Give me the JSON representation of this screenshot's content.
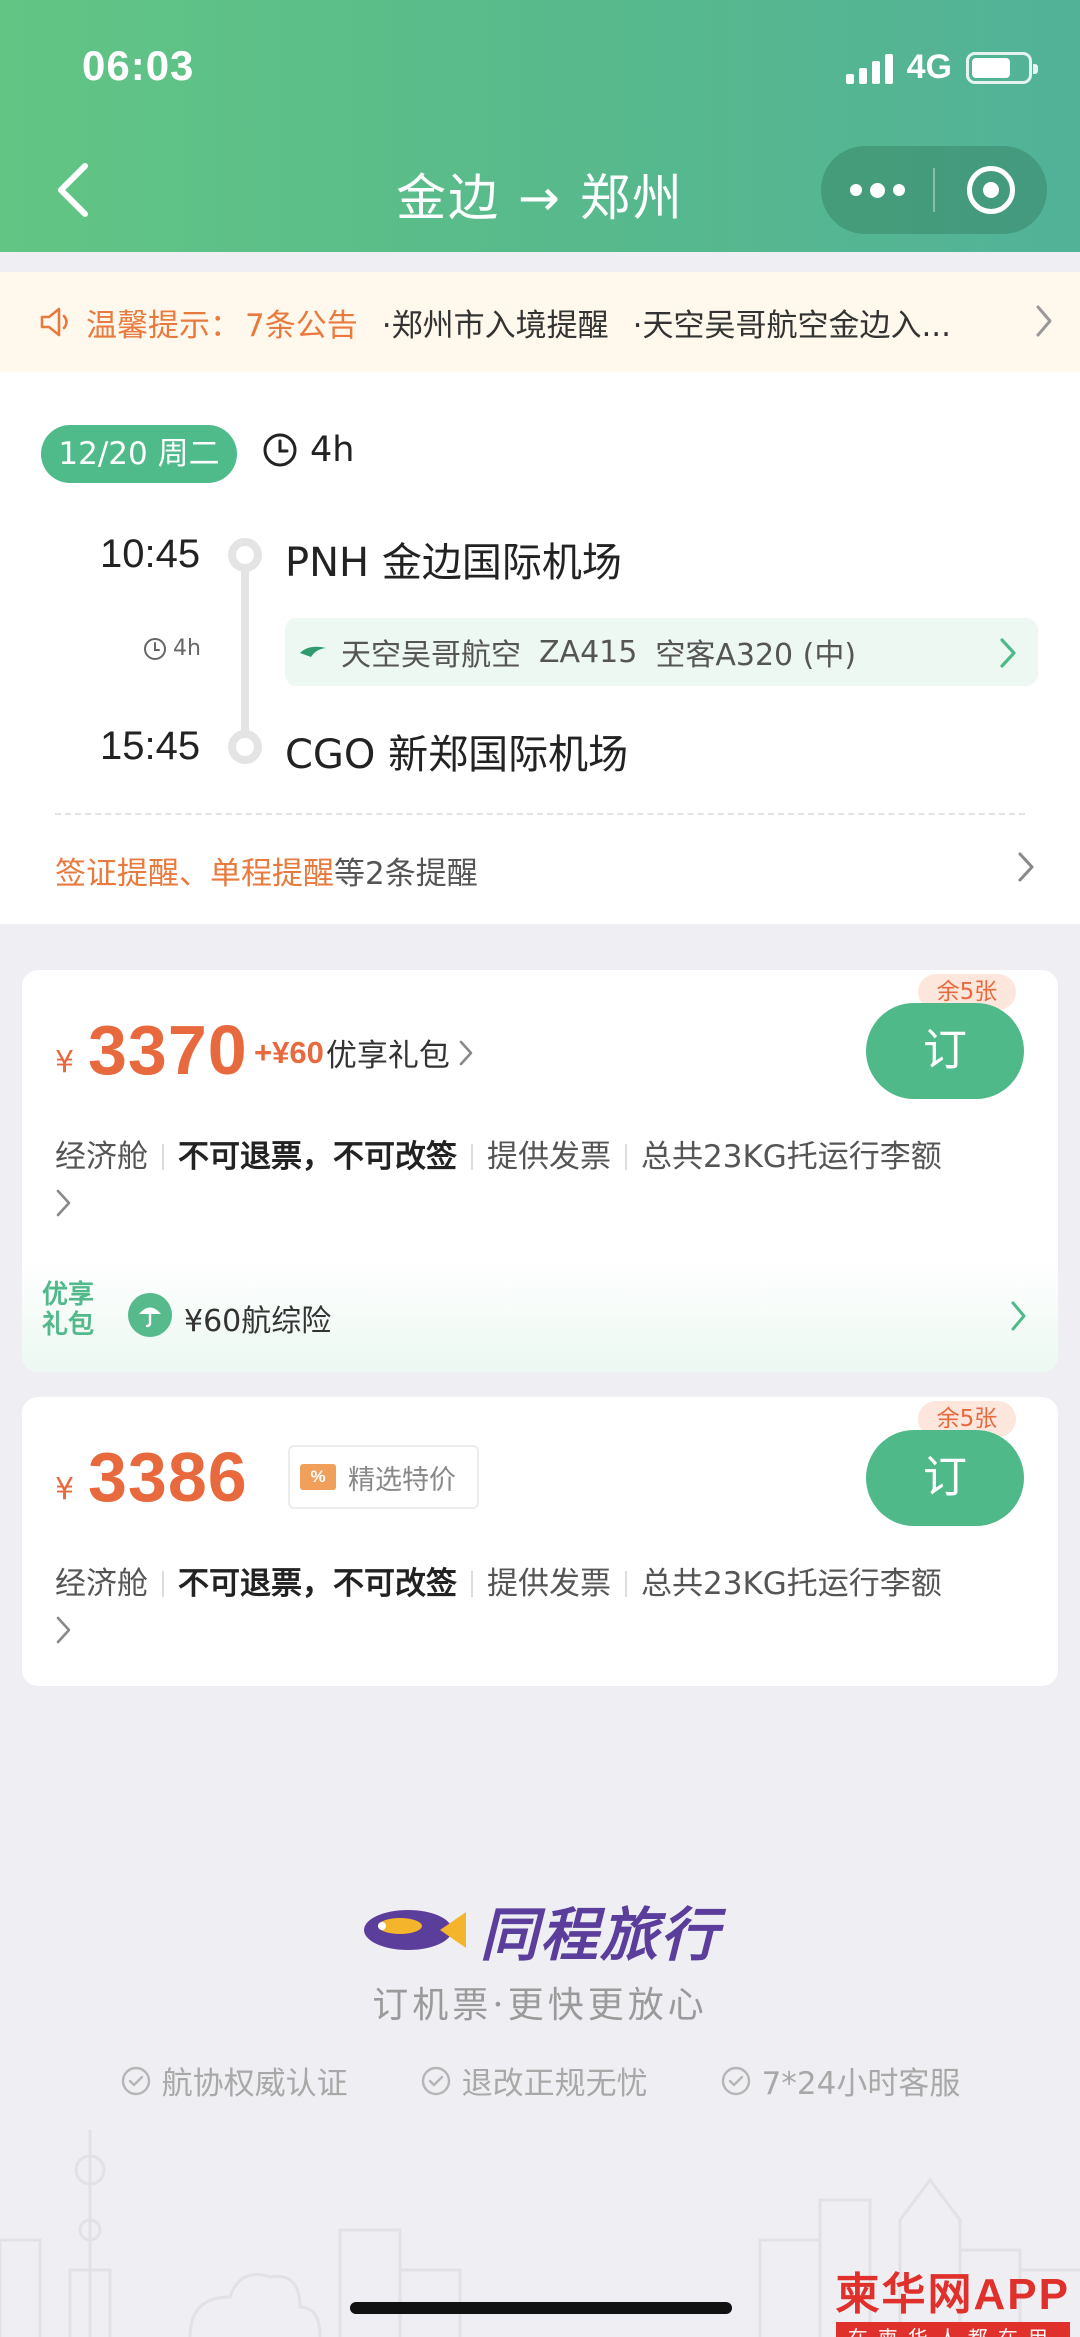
{
  "status_bar": {
    "time": "06:03",
    "network": "4G",
    "battery_level": 0.7
  },
  "nav": {
    "title": "金边 → 郑州"
  },
  "notice": {
    "tip_label": "温馨提示：",
    "count": "7条公告",
    "items": [
      "·郑州市入境提醒",
      "·天空吴哥航空金边入..."
    ]
  },
  "flight": {
    "date": "12/20 周二",
    "total_duration": "4h",
    "departure": {
      "time": "10:45",
      "airport": "PNH 金边国际机场"
    },
    "arrival": {
      "time": "15:45",
      "airport": "CGO 新郑国际机场"
    },
    "leg_duration": "4h",
    "airline": "天空吴哥航空",
    "flight_no": "ZA415",
    "aircraft": "空客A320 (中)",
    "reminder_highlight": "签证提醒、单程提醒",
    "reminder_suffix": "等2条提醒"
  },
  "offers": [
    {
      "currency": "¥",
      "price": "3370",
      "addon_price": "+¥60",
      "addon_name": "优享礼包",
      "remaining": "余5张",
      "book_label": "订",
      "cabin": "经济舱",
      "refund": "不可退票，不可改签",
      "invoice": "提供发票",
      "baggage": "总共23KG托运行李额",
      "gift_label": "优享礼包",
      "gift_item": "¥60航综险"
    },
    {
      "currency": "¥",
      "price": "3386",
      "badge": "精选特价",
      "badge_icon": "%",
      "remaining": "余5张",
      "book_label": "订",
      "cabin": "经济舱",
      "refund": "不可退票，不可改签",
      "invoice": "提供发票",
      "baggage": "总共23KG托运行李额"
    }
  ],
  "footer": {
    "brand": "同程旅行",
    "slogan": "订机票·更快更放心",
    "guarantees": [
      "航协权威认证",
      "退改正规无忧",
      "7*24小时客服"
    ]
  },
  "watermark": {
    "main": "柬华网APP",
    "sub": "在柬华人都在用"
  },
  "colors": {
    "header": "#5bbf88",
    "accent_orange": "#e8693d",
    "button_green": "#4fb989",
    "brand_purple": "#5b3e9c"
  }
}
